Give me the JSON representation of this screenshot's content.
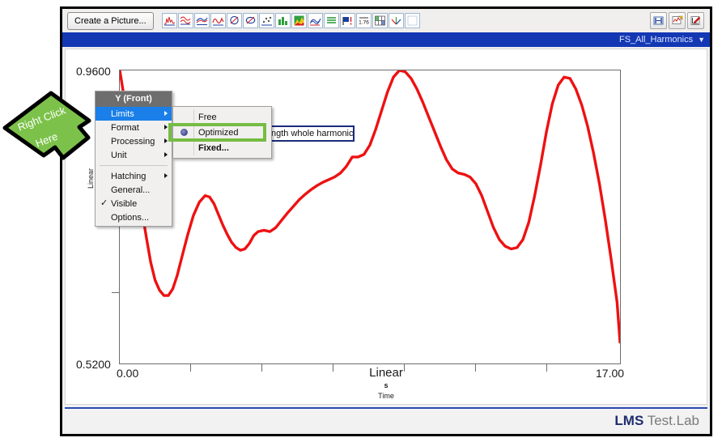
{
  "window": {
    "toolbar": {
      "create_picture_label": "Create a Picture...",
      "icons": [
        "waveform-peak-icon",
        "overlay-curves-icon",
        "averaged-curve-icon",
        "smooth-curve-icon",
        "polar-plot-icon",
        "nyquist-plot-icon",
        "scatter-points-icon",
        "bar-chart-icon",
        "color-map-icon",
        "waterfall-icon",
        "list-lines-icon",
        "annotate-flag-icon",
        "numeric-value-icon",
        "matrix-grid-icon",
        "3d-axes-icon",
        "blank-frame-icon"
      ],
      "right_icons": [
        "fit-width-icon",
        "new-picture-icon",
        "edit-picture-icon"
      ]
    },
    "title_bar": {
      "dropdown_label": "FS_All_Harmonics",
      "dropdown_caret": "caret-down-icon"
    },
    "status_bar": {
      "logo_bold": "LMS",
      "logo_light": " Test.Lab"
    }
  },
  "hidden_textbox": {
    "value": "ngth whole harmonics"
  },
  "context_menu": {
    "header": "Y (Front)",
    "items": [
      {
        "label": "Limits",
        "submenu": true,
        "selected": true,
        "check": ""
      },
      {
        "label": "Format",
        "submenu": true,
        "selected": false,
        "check": ""
      },
      {
        "label": "Processing",
        "submenu": true,
        "selected": false,
        "check": ""
      },
      {
        "label": "Unit",
        "submenu": true,
        "selected": false,
        "check": ""
      },
      {
        "label": "Hatching",
        "submenu": true,
        "selected": false,
        "check": ""
      },
      {
        "label": "General...",
        "submenu": false,
        "selected": false,
        "check": ""
      },
      {
        "label": "Visible",
        "submenu": false,
        "selected": false,
        "check": "✓"
      },
      {
        "label": "Options...",
        "submenu": false,
        "selected": false,
        "check": ""
      }
    ],
    "submenu": {
      "items": [
        {
          "label": "Free",
          "radio": false,
          "bold": false
        },
        {
          "label": "Optimized",
          "radio": true,
          "bold": false
        },
        {
          "label": "Fixed...",
          "radio": false,
          "bold": true
        }
      ],
      "highlighted": "Optimized",
      "highlight_color": "#76bc43"
    }
  },
  "annotation": {
    "arrow_line1": "Right Click",
    "arrow_line2": "Here",
    "arrow_color": "#7cc24a",
    "arrow_outline": "#000000"
  },
  "chart_data": {
    "type": "line",
    "title": "",
    "xlabel": "Linear",
    "xunit": "s",
    "xquantity": "Time",
    "ylabel": "Linear",
    "xlim": [
      0.0,
      17.0
    ],
    "ylim": [
      0.52,
      0.96
    ],
    "xtick_labels": [
      "0.00",
      "17.00"
    ],
    "ytick_labels": [
      "0.9600",
      "0.5200"
    ],
    "xticks_count": 6,
    "yticks_count": 2,
    "grid": false,
    "legend": false,
    "series": [
      {
        "name": "FS_All_Harmonics",
        "color": "#ee1111",
        "x": [
          0.0,
          0.2,
          0.4,
          0.6,
          0.75,
          0.9,
          1.05,
          1.2,
          1.35,
          1.5,
          1.65,
          1.8,
          1.95,
          2.1,
          2.3,
          2.5,
          2.7,
          2.9,
          3.05,
          3.2,
          3.35,
          3.5,
          3.65,
          3.8,
          3.95,
          4.1,
          4.25,
          4.4,
          4.55,
          4.7,
          4.9,
          5.1,
          5.3,
          5.5,
          5.7,
          5.9,
          6.1,
          6.3,
          6.5,
          6.7,
          6.9,
          7.1,
          7.3,
          7.5,
          7.7,
          7.9,
          8.1,
          8.3,
          8.5,
          8.7,
          8.9,
          9.1,
          9.3,
          9.5,
          9.7,
          9.9,
          10.1,
          10.3,
          10.5,
          10.7,
          10.9,
          11.1,
          11.3,
          11.5,
          11.7,
          11.9,
          12.1,
          12.3,
          12.5,
          12.7,
          12.9,
          13.1,
          13.3,
          13.5,
          13.7,
          13.9,
          14.1,
          14.3,
          14.5,
          14.7,
          14.9,
          15.1,
          15.3,
          15.5,
          15.7,
          15.9,
          16.1,
          16.3,
          16.5,
          16.7,
          16.9,
          17.0
        ],
        "y": [
          0.96,
          0.905,
          0.845,
          0.79,
          0.75,
          0.71,
          0.672,
          0.645,
          0.63,
          0.622,
          0.622,
          0.632,
          0.652,
          0.678,
          0.712,
          0.742,
          0.762,
          0.772,
          0.77,
          0.76,
          0.744,
          0.728,
          0.714,
          0.702,
          0.694,
          0.69,
          0.692,
          0.7,
          0.712,
          0.718,
          0.72,
          0.718,
          0.724,
          0.735,
          0.746,
          0.756,
          0.766,
          0.774,
          0.781,
          0.787,
          0.792,
          0.796,
          0.8,
          0.806,
          0.816,
          0.83,
          0.83,
          0.834,
          0.848,
          0.872,
          0.9,
          0.928,
          0.95,
          0.96,
          0.958,
          0.948,
          0.932,
          0.912,
          0.89,
          0.868,
          0.846,
          0.826,
          0.812,
          0.806,
          0.804,
          0.8,
          0.79,
          0.772,
          0.748,
          0.724,
          0.706,
          0.696,
          0.692,
          0.694,
          0.706,
          0.732,
          0.772,
          0.818,
          0.868,
          0.91,
          0.938,
          0.95,
          0.948,
          0.932,
          0.908,
          0.876,
          0.836,
          0.79,
          0.736,
          0.676,
          0.612,
          0.552,
          0.522
        ]
      }
    ]
  }
}
